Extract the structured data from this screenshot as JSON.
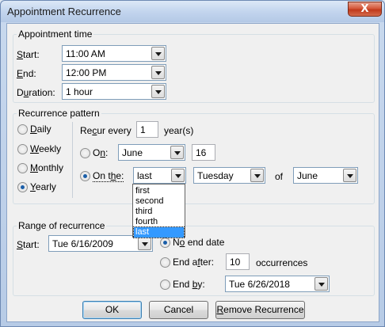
{
  "window": {
    "title": "Appointment Recurrence",
    "close_glyph": "X"
  },
  "appointment_time": {
    "legend": "Appointment time",
    "start": {
      "label_u": "S",
      "label_rest": "tart:",
      "value": "11:00 AM"
    },
    "end": {
      "label_u": "E",
      "label_rest": "nd:",
      "value": "12:00 PM"
    },
    "duration": {
      "label_pre": "D",
      "label_u": "u",
      "label_rest": "ration:",
      "value": "1 hour"
    }
  },
  "recurrence_pattern": {
    "legend": "Recurrence pattern",
    "frequencies": [
      {
        "pre": "",
        "u": "D",
        "rest": "aily",
        "selected": false
      },
      {
        "pre": "",
        "u": "W",
        "rest": "eekly",
        "selected": false
      },
      {
        "pre": "",
        "u": "M",
        "rest": "onthly",
        "selected": false
      },
      {
        "pre": "",
        "u": "Y",
        "rest": "early",
        "selected": true
      }
    ],
    "recur_every": {
      "label_pre": "Re",
      "label_u": "c",
      "label_rest": "ur every",
      "value": "1",
      "suffix": "year(s)"
    },
    "on": {
      "label_pre": "O",
      "label_u": "n",
      "label_rest": ":",
      "month": "June",
      "day": "16",
      "selected": false
    },
    "on_the": {
      "label_pre": "On t",
      "label_u": "h",
      "label_rest": "e:",
      "ordinal": "last",
      "weekday": "Tuesday",
      "of_label": "of",
      "month": "June",
      "selected": true
    },
    "ordinal_options": [
      "first",
      "second",
      "third",
      "fourth",
      "last"
    ],
    "ordinal_selected": "last"
  },
  "range": {
    "legend": "Range of recurrence",
    "start": {
      "label_pre": "S",
      "label_u": "t",
      "label_rest": "art:",
      "value": "Tue 6/16/2009"
    },
    "no_end": {
      "label_pre": "N",
      "label_u": "o",
      "label_rest": " end date",
      "selected": true
    },
    "end_after": {
      "label_pre": "End a",
      "label_u": "f",
      "label_rest": "ter:",
      "value": "10",
      "suffix": "occurrences",
      "selected": false
    },
    "end_by": {
      "label_pre": "End ",
      "label_u": "b",
      "label_rest": "y:",
      "value": "Tue 6/26/2018",
      "selected": false
    }
  },
  "buttons": {
    "ok": "OK",
    "cancel": "Cancel",
    "remove": {
      "pre": "",
      "u": "R",
      "rest": "emove Recurrence"
    }
  }
}
